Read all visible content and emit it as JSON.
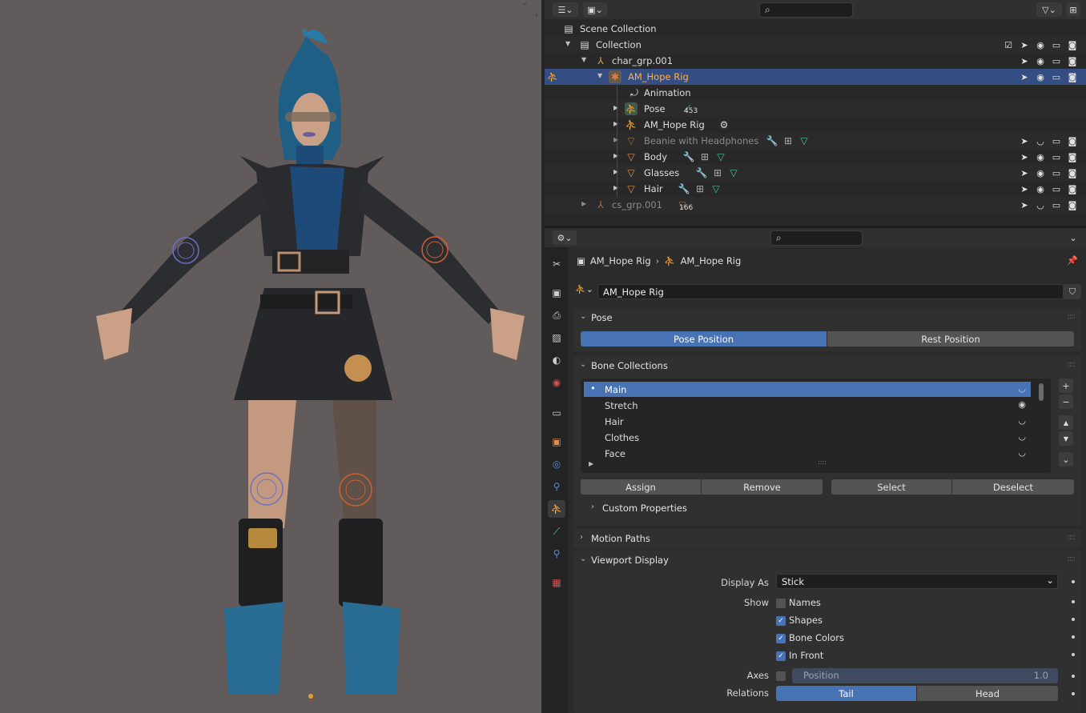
{
  "outliner": {
    "search_placeholder": "",
    "rows": [
      {
        "label": "Scene Collection"
      },
      {
        "label": "Collection"
      },
      {
        "label": "char_grp.001"
      },
      {
        "label": "AM_Hope Rig"
      },
      {
        "label": "Animation"
      },
      {
        "label": "Pose",
        "badge": "453"
      },
      {
        "label": "AM_Hope Rig"
      },
      {
        "label": "Beanie with Headphones"
      },
      {
        "label": "Body"
      },
      {
        "label": "Glasses"
      },
      {
        "label": "Hair"
      },
      {
        "label": "cs_grp.001",
        "badge": "166"
      }
    ]
  },
  "properties": {
    "breadcrumb": {
      "object": "AM_Hope Rig",
      "data": "AM_Hope Rig"
    },
    "data_name": "AM_Hope Rig",
    "pose_panel": {
      "title": "Pose",
      "pose_position": "Pose Position",
      "rest_position": "Rest Position"
    },
    "bone_collections": {
      "title": "Bone Collections",
      "items": [
        "Main",
        "Stretch",
        "Hair",
        "Clothes",
        "Face"
      ],
      "assign": "Assign",
      "remove": "Remove",
      "select": "Select",
      "deselect": "Deselect",
      "custom_properties": "Custom Properties"
    },
    "motion_paths": {
      "title": "Motion Paths"
    },
    "viewport_display": {
      "title": "Viewport Display",
      "display_as_label": "Display As",
      "display_as_value": "Stick",
      "show_label": "Show",
      "names": "Names",
      "shapes": "Shapes",
      "bone_colors": "Bone Colors",
      "in_front": "In Front",
      "axes_label": "Axes",
      "axes_position": "Position",
      "axes_value": "1.0",
      "relations_label": "Relations",
      "tail": "Tail",
      "head": "Head"
    }
  },
  "colors": {
    "accent": "#4772b3",
    "selection": "#344d82",
    "viewport_bg": "#625b5b"
  }
}
